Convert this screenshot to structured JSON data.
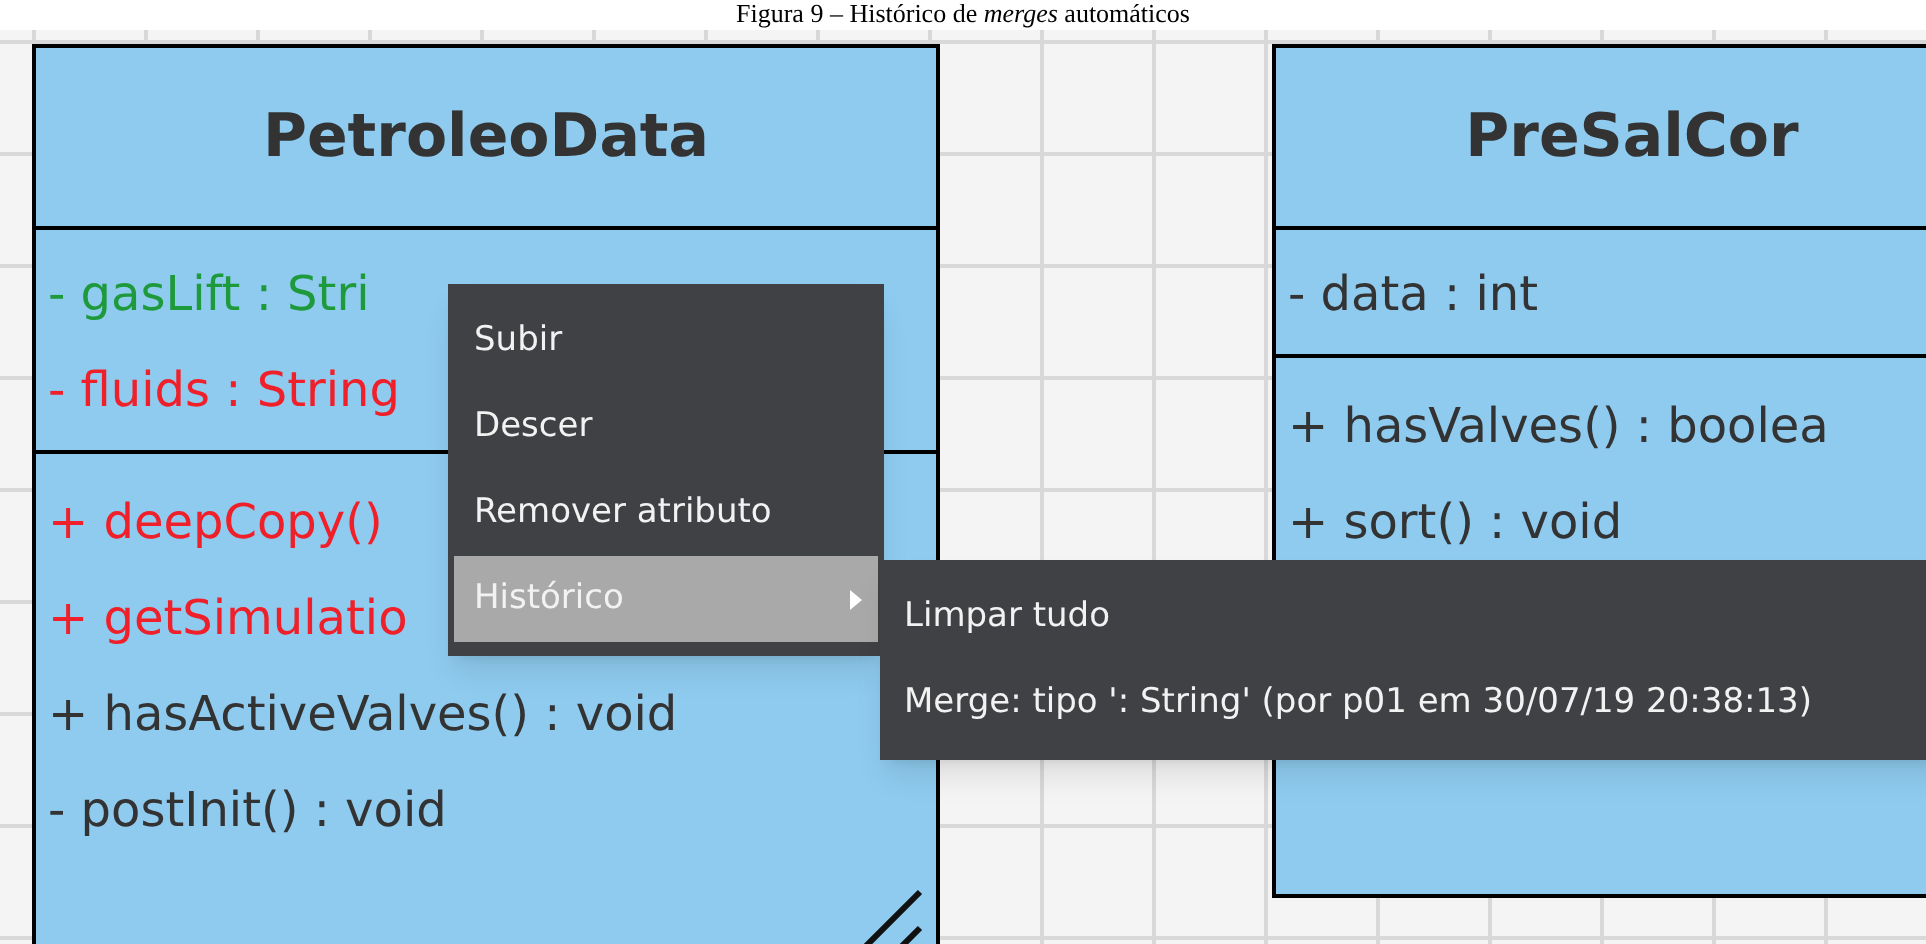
{
  "caption": "Figura 9 – Histórico de *merges* automáticos",
  "classes": [
    {
      "name": "PetroleoData",
      "attributes": [
        {
          "text": "- gasLift : Stri",
          "color": "#1e9a3c"
        },
        {
          "text": "- fluids : String",
          "color": "#f0202a"
        }
      ],
      "methods": [
        {
          "text": "+ deepCopy()",
          "color": "#f0202a"
        },
        {
          "text": "+ getSimulatio",
          "color": "#f0202a"
        },
        {
          "text": "+ hasActiveValves() : void"
        },
        {
          "text": "- postInit() : void"
        }
      ]
    },
    {
      "name": "PreSalCor",
      "attributes": [
        {
          "text": "- data : int"
        }
      ],
      "methods": [
        {
          "text": "+ hasValves() : boolea"
        },
        {
          "text": "+ sort() : void"
        }
      ]
    }
  ],
  "context_menu": {
    "items": [
      {
        "label": "Subir",
        "selected": false,
        "has_submenu": false
      },
      {
        "label": "Descer",
        "selected": false,
        "has_submenu": false
      },
      {
        "label": "Remover atributo",
        "selected": false,
        "has_submenu": false
      },
      {
        "label": "Histórico",
        "selected": true,
        "has_submenu": true
      }
    ]
  },
  "submenu": {
    "items": [
      {
        "label": "Limpar tudo"
      },
      {
        "label": "Merge: tipo ': String' (por p01 em 30/07/19 20:38:13)"
      }
    ]
  }
}
